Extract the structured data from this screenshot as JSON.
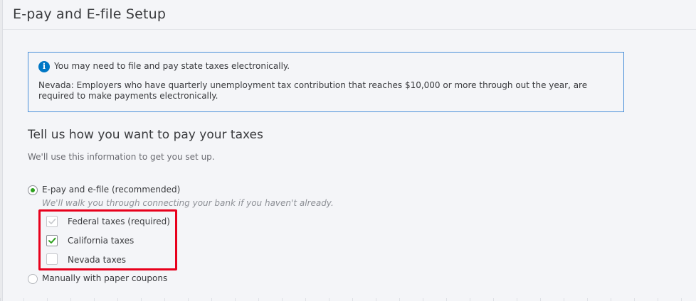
{
  "page": {
    "title": "E-pay and E-file Setup"
  },
  "notice": {
    "icon": "info-icon",
    "icon_glyph": "i",
    "headline": "You may need to file and pay state taxes electronically.",
    "body": "Nevada: Employers who have quarterly unemployment tax contribution that reaches $10,000 or more through out the year, are required to make payments electronically."
  },
  "payment": {
    "title": "Tell us how you want to pay your taxes",
    "subtitle": "We'll use this information to get you set up.",
    "options": [
      {
        "label": "E-pay and e-file (recommended)",
        "hint": "We'll walk you through connecting your bank if you haven't already.",
        "selected": true
      },
      {
        "label": "Manually with paper coupons",
        "selected": false
      }
    ],
    "taxes": [
      {
        "label": "Federal taxes (required)",
        "checked": true,
        "disabled": true
      },
      {
        "label": "California taxes",
        "checked": true,
        "disabled": false
      },
      {
        "label": "Nevada taxes",
        "checked": false,
        "disabled": false
      }
    ]
  },
  "colors": {
    "accent_green": "#2ca01c",
    "info_blue": "#0077c5",
    "highlight_red": "#e8001c"
  }
}
